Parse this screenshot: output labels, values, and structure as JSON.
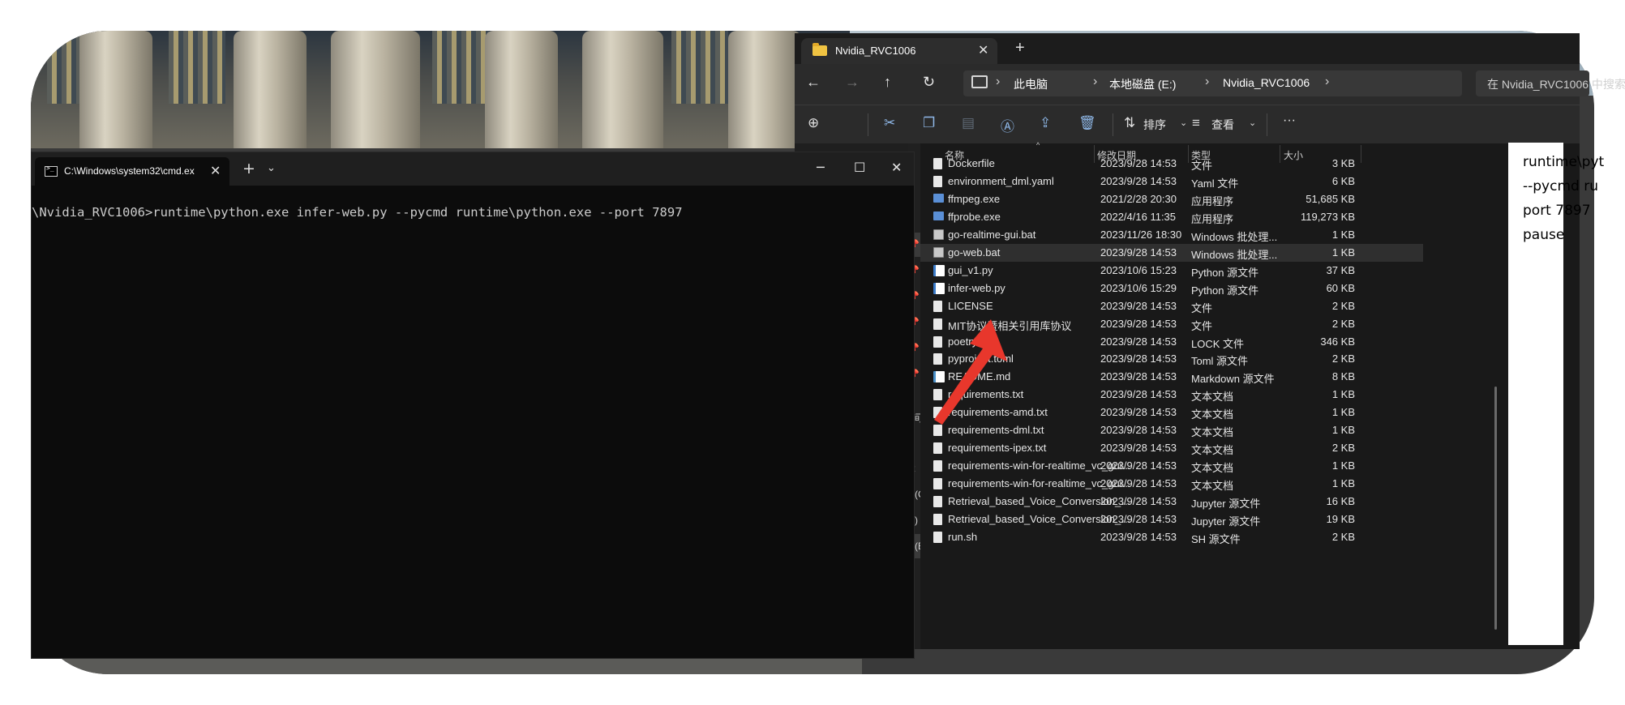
{
  "cmd": {
    "tab_title": "C:\\Windows\\system32\\cmd.ex",
    "close": "✕",
    "new_tab": "+",
    "dropdown": "⌄",
    "minimize": "─",
    "maximize": "☐",
    "close_window": "✕",
    "command_line": "\\Nvidia_RVC1006>runtime\\python.exe infer-web.py --pycmd runtime\\python.exe --port 7897"
  },
  "explorer": {
    "tab_title": "Nvidia_RVC1006",
    "tab_close": "✕",
    "new_tab": "+",
    "nav": {
      "back": "←",
      "forward": "→",
      "up": "↑",
      "refresh": "↻"
    },
    "breadcrumb": [
      "此电脑",
      "本地磁盘 (E:)",
      "Nvidia_RVC1006"
    ],
    "breadcrumb_sep": "›",
    "search_placeholder": "在 Nvidia_RVC1006 中搜索",
    "toolbar": {
      "sort": "排序",
      "view": "查看",
      "more": "···"
    },
    "sidebar_labels": [
      "间",
      "t",
      "(C:)",
      ")",
      "(E:)"
    ],
    "columns": {
      "name": "名称",
      "date": "修改日期",
      "type": "类型",
      "size": "大小"
    },
    "files": [
      {
        "name": "Dockerfile",
        "date": "2023/9/28 14:53",
        "type": "文件",
        "size": "3 KB",
        "icon": "file"
      },
      {
        "name": "environment_dml.yaml",
        "date": "2023/9/28 14:53",
        "type": "Yaml 文件",
        "size": "6 KB",
        "icon": "file"
      },
      {
        "name": "ffmpeg.exe",
        "date": "2021/2/28 20:30",
        "type": "应用程序",
        "size": "51,685 KB",
        "icon": "exe"
      },
      {
        "name": "ffprobe.exe",
        "date": "2022/4/16 11:35",
        "type": "应用程序",
        "size": "119,273 KB",
        "icon": "exe"
      },
      {
        "name": "go-realtime-gui.bat",
        "date": "2023/11/26 18:30",
        "type": "Windows 批处理...",
        "size": "1 KB",
        "icon": "bat"
      },
      {
        "name": "go-web.bat",
        "date": "2023/9/28 14:53",
        "type": "Windows 批处理...",
        "size": "1 KB",
        "icon": "bat"
      },
      {
        "name": "gui_v1.py",
        "date": "2023/10/6 15:23",
        "type": "Python 源文件",
        "size": "37 KB",
        "icon": "py"
      },
      {
        "name": "infer-web.py",
        "date": "2023/10/6 15:29",
        "type": "Python 源文件",
        "size": "60 KB",
        "icon": "py"
      },
      {
        "name": "LICENSE",
        "date": "2023/9/28 14:53",
        "type": "文件",
        "size": "2 KB",
        "icon": "file"
      },
      {
        "name": "MIT协议暨相关引用库协议",
        "date": "2023/9/28 14:53",
        "type": "文件",
        "size": "2 KB",
        "icon": "file"
      },
      {
        "name": "poetry.lock",
        "date": "2023/9/28 14:53",
        "type": "LOCK 文件",
        "size": "346 KB",
        "icon": "file"
      },
      {
        "name": "pyproject.toml",
        "date": "2023/9/28 14:53",
        "type": "Toml 源文件",
        "size": "2 KB",
        "icon": "file"
      },
      {
        "name": "README.md",
        "date": "2023/9/28 14:53",
        "type": "Markdown 源文件",
        "size": "8 KB",
        "icon": "md"
      },
      {
        "name": "requirements.txt",
        "date": "2023/9/28 14:53",
        "type": "文本文档",
        "size": "1 KB",
        "icon": "file"
      },
      {
        "name": "requirements-amd.txt",
        "date": "2023/9/28 14:53",
        "type": "文本文档",
        "size": "1 KB",
        "icon": "file"
      },
      {
        "name": "requirements-dml.txt",
        "date": "2023/9/28 14:53",
        "type": "文本文档",
        "size": "1 KB",
        "icon": "file"
      },
      {
        "name": "requirements-ipex.txt",
        "date": "2023/9/28 14:53",
        "type": "文本文档",
        "size": "2 KB",
        "icon": "file"
      },
      {
        "name": "requirements-win-for-realtime_vc_gui...",
        "date": "2023/9/28 14:53",
        "type": "文本文档",
        "size": "1 KB",
        "icon": "file"
      },
      {
        "name": "requirements-win-for-realtime_vc_gui...",
        "date": "2023/9/28 14:53",
        "type": "文本文档",
        "size": "1 KB",
        "icon": "file"
      },
      {
        "name": "Retrieval_based_Voice_Conversion_W...",
        "date": "2023/9/28 14:53",
        "type": "Jupyter 源文件",
        "size": "16 KB",
        "icon": "file"
      },
      {
        "name": "Retrieval_based_Voice_Conversion_W...",
        "date": "2023/9/28 14:53",
        "type": "Jupyter 源文件",
        "size": "19 KB",
        "icon": "file"
      },
      {
        "name": "run.sh",
        "date": "2023/9/28 14:53",
        "type": "SH 源文件",
        "size": "2 KB",
        "icon": "file"
      }
    ],
    "selected_index": 5
  },
  "preview": {
    "lines": [
      "runtime\\pyt",
      "--pycmd ru",
      "port 7897",
      "pause"
    ]
  },
  "colors": {
    "arrow": "#e8372c",
    "explorer_bg": "#202020",
    "cmd_bg": "#0c0c0c"
  }
}
